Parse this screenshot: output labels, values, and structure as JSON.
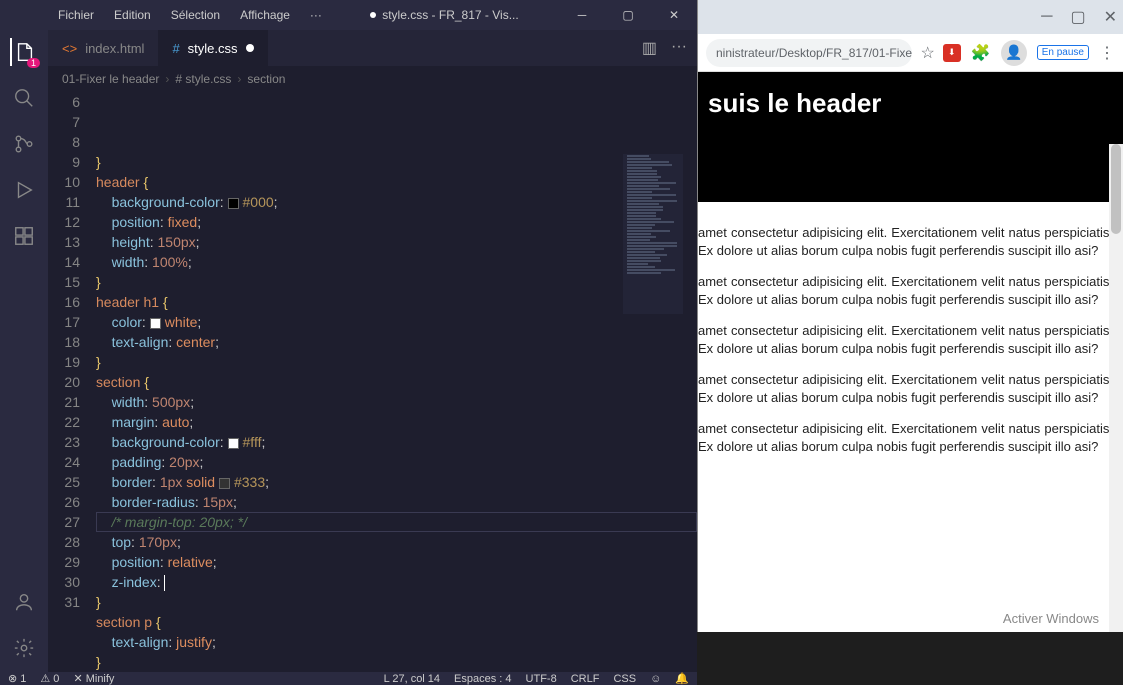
{
  "vscode": {
    "menu": [
      "Fichier",
      "Edition",
      "Sélection",
      "Affichage",
      "···"
    ],
    "title": "style.css - FR_817 - Vis...",
    "tabs": [
      {
        "icon": "html",
        "label": "index.html",
        "active": false,
        "dirty": false
      },
      {
        "icon": "css",
        "label": "style.css",
        "active": true,
        "dirty": true
      }
    ],
    "breadcrumb": [
      "01-Fixer le header",
      "# style.css",
      "section"
    ],
    "activity_badge": "1",
    "code_lines": [
      {
        "n": 6,
        "html": "<span class='tok-brace'>}</span>"
      },
      {
        "n": 7,
        "html": "<span class='tok-sel'>header</span> <span class='tok-brace'>{</span>"
      },
      {
        "n": 8,
        "html": "    <span class='tok-prop'>background-color</span><span class='tok-punc'>:</span> <span class='color-box' style='background:#000'></span><span class='tok-str'>#000</span><span class='tok-punc'>;</span>"
      },
      {
        "n": 9,
        "html": "    <span class='tok-prop'>position</span><span class='tok-punc'>:</span> <span class='tok-val'>fixed</span><span class='tok-punc'>;</span>"
      },
      {
        "n": 10,
        "html": "    <span class='tok-prop'>height</span><span class='tok-punc'>:</span> <span class='tok-num'>150px</span><span class='tok-punc'>;</span>"
      },
      {
        "n": 11,
        "html": "    <span class='tok-prop'>width</span><span class='tok-punc'>:</span> <span class='tok-num'>100%</span><span class='tok-punc'>;</span>"
      },
      {
        "n": 12,
        "html": "<span class='tok-brace'>}</span>"
      },
      {
        "n": 13,
        "html": "<span class='tok-sel'>header h1</span> <span class='tok-brace'>{</span>"
      },
      {
        "n": 14,
        "html": "    <span class='tok-prop'>color</span><span class='tok-punc'>:</span> <span class='color-box' style='background:#fff'></span><span class='tok-val'>white</span><span class='tok-punc'>;</span>"
      },
      {
        "n": 15,
        "html": "    <span class='tok-prop'>text-align</span><span class='tok-punc'>:</span> <span class='tok-val'>center</span><span class='tok-punc'>;</span>"
      },
      {
        "n": 16,
        "html": "<span class='tok-brace'>}</span>"
      },
      {
        "n": 17,
        "html": "<span class='tok-sel'>section</span> <span class='tok-brace'>{</span>"
      },
      {
        "n": 18,
        "html": "    <span class='tok-prop'>width</span><span class='tok-punc'>:</span> <span class='tok-num'>500px</span><span class='tok-punc'>;</span>"
      },
      {
        "n": 19,
        "html": "    <span class='tok-prop'>margin</span><span class='tok-punc'>:</span> <span class='tok-val'>auto</span><span class='tok-punc'>;</span>"
      },
      {
        "n": 20,
        "html": "    <span class='tok-prop'>background-color</span><span class='tok-punc'>:</span> <span class='color-box' style='background:#fff'></span><span class='tok-str'>#fff</span><span class='tok-punc'>;</span>"
      },
      {
        "n": 21,
        "html": "    <span class='tok-prop'>padding</span><span class='tok-punc'>:</span> <span class='tok-num'>20px</span><span class='tok-punc'>;</span>"
      },
      {
        "n": 22,
        "html": "    <span class='tok-prop'>border</span><span class='tok-punc'>:</span> <span class='tok-num'>1px</span> <span class='tok-val'>solid</span> <span class='color-box' style='background:#333'></span><span class='tok-str'>#333</span><span class='tok-punc'>;</span>"
      },
      {
        "n": 23,
        "html": "    <span class='tok-prop'>border-radius</span><span class='tok-punc'>:</span> <span class='tok-num'>15px</span><span class='tok-punc'>;</span>"
      },
      {
        "n": 24,
        "html": "    <span class='tok-comment'>/* margin-top: 20px; */</span>"
      },
      {
        "n": 25,
        "html": "    <span class='tok-prop'>top</span><span class='tok-punc'>:</span> <span class='tok-num'>170px</span><span class='tok-punc'>;</span>"
      },
      {
        "n": 26,
        "html": "    <span class='tok-prop'>position</span><span class='tok-punc'>:</span> <span class='tok-val'>relative</span><span class='tok-punc'>;</span>"
      },
      {
        "n": 27,
        "html": "    <span class='tok-prop'>z-index</span><span class='tok-punc'>:</span> <span class='cursor'></span>"
      },
      {
        "n": 28,
        "html": "<span class='tok-brace'>}</span>"
      },
      {
        "n": 29,
        "html": "<span class='tok-sel'>section p</span> <span class='tok-brace'>{</span>"
      },
      {
        "n": 30,
        "html": "    <span class='tok-prop'>text-align</span><span class='tok-punc'>:</span> <span class='tok-val'>justify</span><span class='tok-punc'>;</span>"
      },
      {
        "n": 31,
        "html": "<span class='tok-brace'>}</span>"
      }
    ],
    "status": {
      "errors": "⊗ 1",
      "warnings": "⚠ 0",
      "minify": "✕ Minify",
      "position": "L 27, col 14",
      "spaces": "Espaces : 4",
      "encoding": "UTF-8",
      "eol": "CRLF",
      "lang": "CSS",
      "feedback": "☺"
    }
  },
  "browser": {
    "url": "ninistrateur/Desktop/FR_817/01-Fixer...",
    "pause": "En pause",
    "header_text": "suis le header",
    "paragraph": "amet consectetur adipisicing elit. Exercitationem velit natus perspiciatis. Ex dolore ut alias borum culpa nobis fugit perferendis suscipit illo asi?",
    "para_count": 5,
    "watermark": "Activer Windows"
  }
}
